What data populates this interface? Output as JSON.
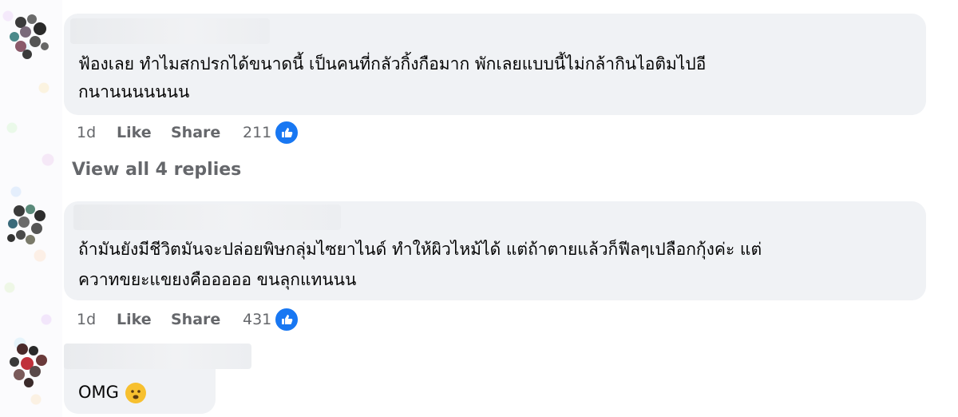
{
  "comments": [
    {
      "text_line1": "ฟ้องเลย ทำไมสกปรกได้ขนาดนี้ เป็นคนที่กลัวกิ้งกือมาก พักเลยแบบนี้ไม่กล้ากินไอติมไปอี",
      "text_line2": "กนานนนนนนน",
      "time": "1d",
      "like_label": "Like",
      "share_label": "Share",
      "reaction_count": "211"
    },
    {
      "text_line1": "ถ้ามันยังมีชีวิตมันจะปล่อยพิษกลุ่มไซยาไนด์ ทำให้ผิวไหม้ได้ แต่ถ้าตายแล้วก็ฟีลๆเปลือกกุ้งค่ะ แต่",
      "text_line2": "ควาทขยะแขยงคือออออ ขนลุกแทนนน",
      "time": "1d",
      "like_label": "Like",
      "share_label": "Share",
      "reaction_count": "431"
    },
    {
      "text_line1": "OMG"
    }
  ],
  "view_replies_label": "View all 4 replies",
  "icons": {
    "reaction": "thumbs-up-icon",
    "emoji": "frowning-face-icon"
  },
  "colors": {
    "bubble": "#f0f2f5",
    "like_blue": "#1877f2",
    "meta_gray": "#65676b"
  }
}
